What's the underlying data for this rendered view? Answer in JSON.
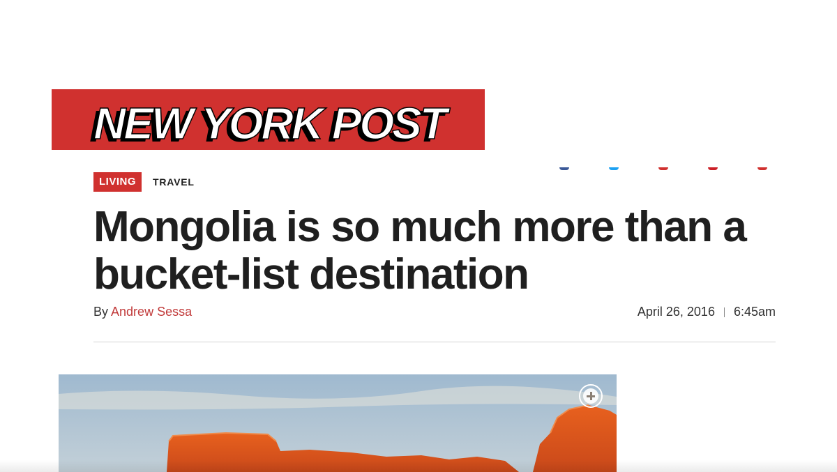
{
  "masthead": {
    "logo_text": "NEW YORK POST",
    "brand_color": "#d0312f"
  },
  "share": {
    "dots": [
      {
        "icon": "facebook-icon",
        "color": "#3b5998"
      },
      {
        "icon": "twitter-icon",
        "color": "#1da1f2"
      },
      {
        "icon": "email-icon",
        "color": "#d0312f"
      },
      {
        "icon": "pinterest-icon",
        "color": "#cb2027"
      },
      {
        "icon": "more-share-icon",
        "color": "#d0312f"
      }
    ]
  },
  "article": {
    "section_tag": "LIVING",
    "subsection_tag": "TRAVEL",
    "headline": "Mongolia is so much more than a bucket-list destination",
    "byline_prefix": "By",
    "author": "Andrew Sessa",
    "date": "April 26, 2016",
    "time": "6:45am"
  },
  "hero_image": {
    "expand_icon": "plus-circle-icon"
  }
}
